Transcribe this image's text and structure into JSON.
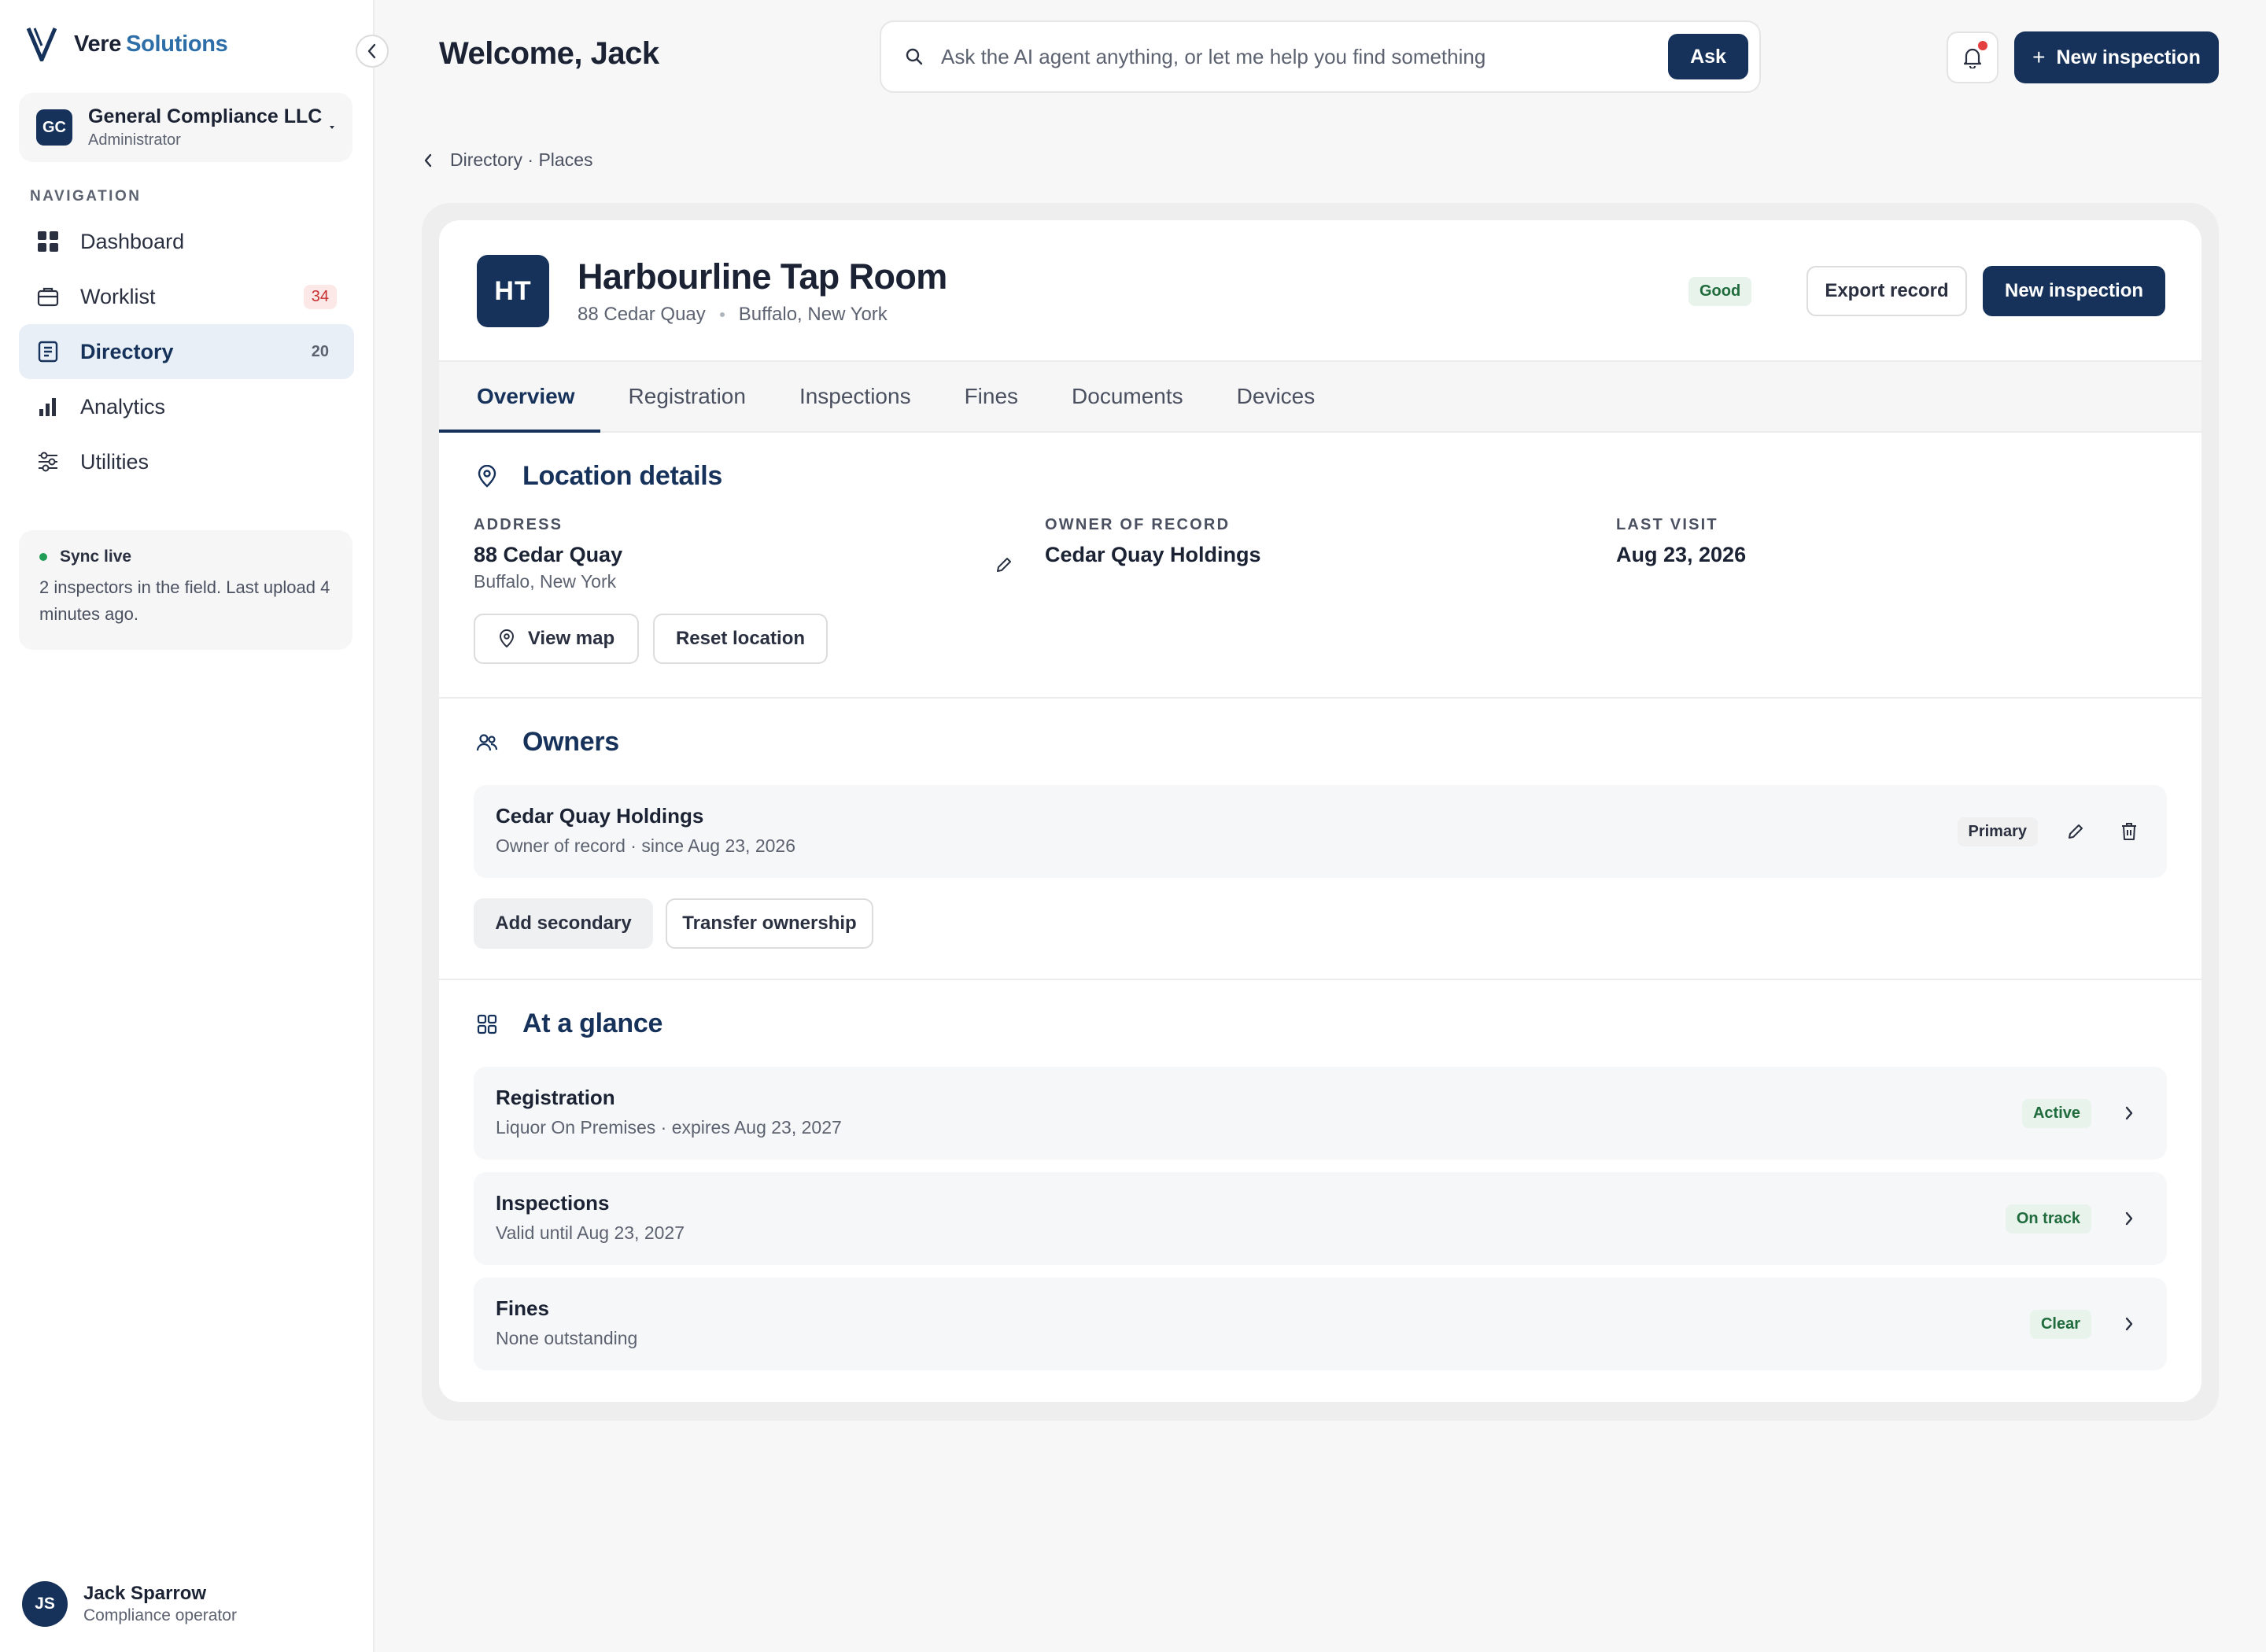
{
  "brand": {
    "name_part1": "Vere",
    "name_part2": "Solutions"
  },
  "org": {
    "initials": "GC",
    "name": "General Compliance LLC",
    "role": "Administrator"
  },
  "nav": {
    "heading": "NAVIGATION",
    "items": [
      {
        "label": "Dashboard",
        "icon": "grid-icon",
        "badge": ""
      },
      {
        "label": "Worklist",
        "icon": "briefcase-icon",
        "badge": "34"
      },
      {
        "label": "Directory",
        "icon": "book-icon",
        "badge": "20"
      },
      {
        "label": "Analytics",
        "icon": "bar-chart-icon",
        "badge": ""
      },
      {
        "label": "Utilities",
        "icon": "sliders-icon",
        "badge": ""
      }
    ],
    "active": "Directory"
  },
  "sync": {
    "title": "Sync live",
    "text": "2 inspectors in the field. Last upload 4 minutes ago."
  },
  "user": {
    "initials": "JS",
    "name": "Jack Sparrow",
    "role": "Compliance operator"
  },
  "header": {
    "welcome": "Welcome, Jack",
    "search_placeholder": "Ask the AI agent anything, or let me help you find something",
    "ask_label": "Ask",
    "new_inspection_label": "New inspection"
  },
  "breadcrumb": "Directory · Places",
  "place": {
    "initials": "HT",
    "name": "Harbourline Tap Room",
    "street": "88 Cedar Quay",
    "city": "Buffalo, New York",
    "status": "Good",
    "export_label": "Export record",
    "new_inspection_label": "New inspection"
  },
  "tabs": [
    "Overview",
    "Registration",
    "Inspections",
    "Fines",
    "Documents",
    "Devices"
  ],
  "location": {
    "title": "Location details",
    "address_label": "ADDRESS",
    "address_line1": "88 Cedar Quay",
    "address_line2": "Buffalo, New York",
    "owner_label": "OWNER OF RECORD",
    "owner_value": "Cedar Quay Holdings",
    "last_visit_label": "LAST VISIT",
    "last_visit_value": "Aug 23, 2026",
    "view_map_label": "View map",
    "reset_label": "Reset location"
  },
  "owners": {
    "title": "Owners",
    "items": [
      {
        "name": "Cedar Quay Holdings",
        "detail": "Owner of record · since Aug 23, 2026",
        "badge": "Primary"
      }
    ],
    "add_secondary_label": "Add secondary",
    "transfer_label": "Transfer ownership"
  },
  "glance": {
    "title": "At a glance",
    "items": [
      {
        "title": "Registration",
        "detail": "Liquor On Premises · expires Aug 23, 2027",
        "badge": "Active"
      },
      {
        "title": "Inspections",
        "detail": "Valid until Aug 23, 2027",
        "badge": "On track"
      },
      {
        "title": "Fines",
        "detail": "None outstanding",
        "badge": "Clear"
      }
    ]
  },
  "colors": {
    "primary": "#16325b",
    "accent": "#2e6ea8",
    "success": "#1f6b3c",
    "danger": "#c53030"
  }
}
